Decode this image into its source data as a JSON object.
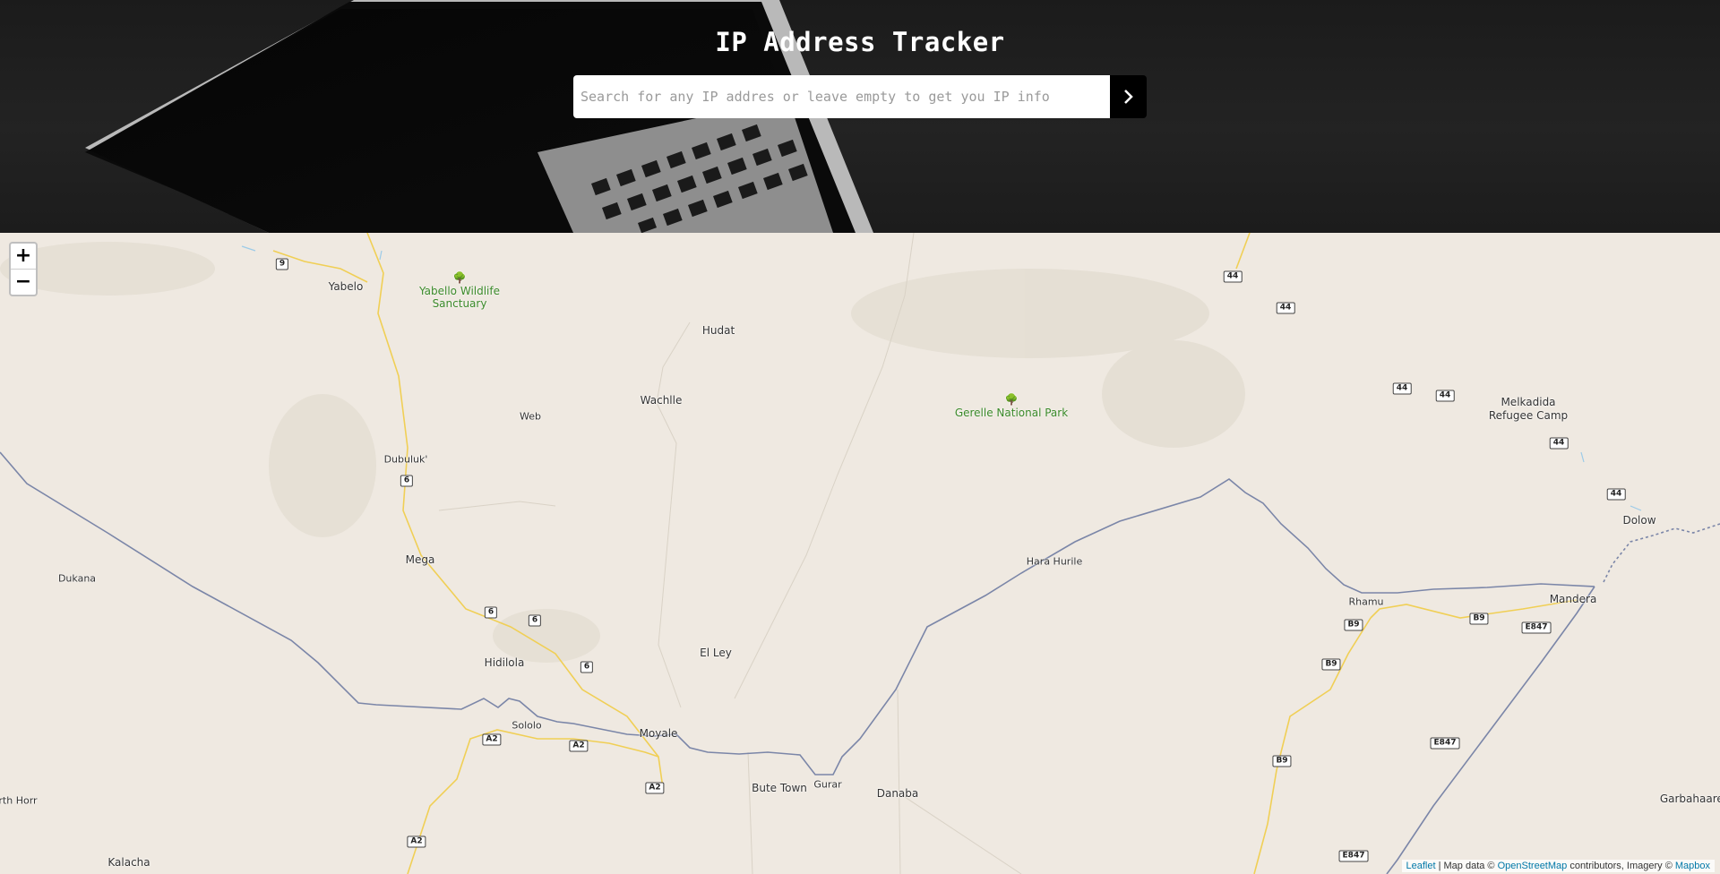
{
  "header": {
    "title": "IP Address Tracker",
    "search": {
      "placeholder": "Search for any IP addres or leave empty to get you IP info",
      "value": "",
      "submit_icon": "chevron-right-icon"
    },
    "background_image": "laptop-keyboard-photo"
  },
  "map": {
    "zoom_in_label": "+",
    "zoom_out_label": "−",
    "places": {
      "yabelo": "Yabelo",
      "hudat": "Hudat",
      "wachlle": "Wachlle",
      "web": "Web",
      "dubuluk": "Dubuluk'",
      "mega": "Mega",
      "dukana": "Dukana",
      "hidilola": "Hidilola",
      "sololo": "Sololo",
      "moyale": "Moyale",
      "el_ley": "El Ley",
      "bute_town": "Bute Town",
      "gurar": "Gurar",
      "danaba": "Danaba",
      "hara_hurile": "Hara Hurile",
      "rhamu": "Rhamu",
      "mandera": "Mandera",
      "melkadida": "Melkadida",
      "refugee_camp": "Refugee Camp",
      "dolow": "Dolow",
      "garbahaaree": "Garbahaaree",
      "north_horr": "rth Horr",
      "kalacha": "Kalacha"
    },
    "parks": {
      "yabello_line1": "Yabello Wildlife",
      "yabello_line2": "Sanctuary",
      "gerelle": "Gerelle National Park"
    },
    "road_shields": {
      "r9": "9",
      "r44a": "44",
      "r44b": "44",
      "r44c": "44",
      "r44d": "44",
      "r44e": "44",
      "r44f": "44",
      "r6a": "6",
      "r6b": "6",
      "r6c": "6",
      "r6d": "6",
      "a2a": "A2",
      "a2b": "A2",
      "a2c": "A2",
      "a2d": "A2",
      "b9a": "B9",
      "b9b": "B9",
      "b9c": "B9",
      "b9d": "B9",
      "e847a": "E847",
      "e847b": "E847",
      "e847c": "E847"
    },
    "attribution": {
      "leaflet": "Leaflet",
      "sep1": " | Map data © ",
      "osm": "OpenStreetMap",
      "sep2": " contributors, Imagery © ",
      "mapbox": "Mapbox"
    },
    "colors": {
      "land": "#efe9e1",
      "border": "#7b86a8",
      "road": "#f0cf55",
      "park_text": "#3b8a2a",
      "link": "#0078a8"
    }
  }
}
